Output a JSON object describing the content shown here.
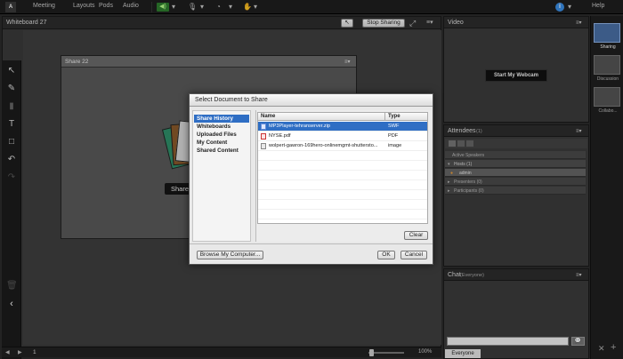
{
  "app": {
    "logo_text": "Adobe"
  },
  "menubar": {
    "items": [
      "Meeting",
      "Layouts",
      "Pods",
      "Audio"
    ],
    "help_label": "Help"
  },
  "whiteboard": {
    "title": "Whiteboard 27",
    "stop_sharing_label": "Stop Sharing",
    "page_number": "1",
    "zoom_level": "100%",
    "inner_share": {
      "title": "Share 22",
      "share_button_label": "Share"
    }
  },
  "video": {
    "title": "Video",
    "webcam_button_label": "Start My Webcam"
  },
  "attendees": {
    "title": "Attendees",
    "count": "(1)",
    "active_speakers_label": "Active Speakers",
    "groups": [
      {
        "label": "Hosts (1)",
        "expanded": true,
        "members": [
          "admin"
        ]
      },
      {
        "label": "Presenters (0)",
        "expanded": false,
        "members": []
      },
      {
        "label": "Participants (0)",
        "expanded": false,
        "members": []
      }
    ]
  },
  "chat": {
    "title": "Chat",
    "subtitle": "(Everyone)",
    "tab_everyone": "Everyone"
  },
  "layouts_panel": {
    "items": [
      "Sharing",
      "Discussion",
      "Collabo..."
    ]
  },
  "dialog": {
    "title": "Select Document to Share",
    "categories": [
      "Share History",
      "Whiteboards",
      "Uploaded Files",
      "My Content",
      "Shared Content"
    ],
    "selected_category": "Share History",
    "columns": [
      "Name",
      "Type"
    ],
    "files": [
      {
        "name": "MP3Player-tehranserver.zip",
        "type": "SWF",
        "selected": true
      },
      {
        "name": "NYSE.pdf",
        "type": "PDF",
        "selected": false
      },
      {
        "name": "wolpert-gawron-169hero-onlinemgmt-shuttersto...",
        "type": "image",
        "selected": false
      }
    ],
    "clear_label": "Clear",
    "browse_label": "Browse My Computer...",
    "ok_label": "OK",
    "cancel_label": "Cancel"
  }
}
